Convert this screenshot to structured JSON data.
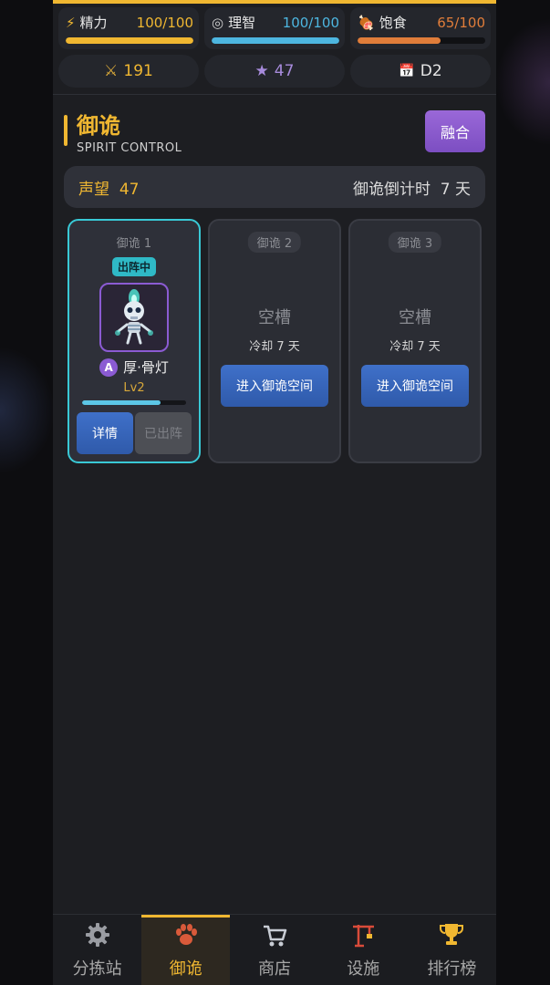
{
  "stats": [
    {
      "icon": "⚡",
      "icon_name": "lightning-icon",
      "name": "精力",
      "value": "100/100",
      "fill": 1.0,
      "color": "#f0b731"
    },
    {
      "icon": "◎",
      "icon_name": "target-icon",
      "name": "理智",
      "value": "100/100",
      "fill": 1.0,
      "color": "#4db6e0"
    },
    {
      "icon": "🍖",
      "icon_name": "meat-icon",
      "name": "饱食",
      "value": "65/100",
      "fill": 0.65,
      "color": "#e07d3a"
    }
  ],
  "chips": [
    {
      "icon": "⚔",
      "icon_name": "swords-icon",
      "value": "191",
      "color": "#f0b731"
    },
    {
      "icon": "★",
      "icon_name": "star-icon",
      "value": "47",
      "color": "#a78bdc"
    },
    {
      "icon": "📅",
      "icon_name": "calendar-icon",
      "value": "D2",
      "color": "#e6e6e6"
    }
  ],
  "header": {
    "title": "御诡",
    "subtitle": "SPIRIT CONTROL",
    "fuse_label": "融合"
  },
  "reputation": {
    "label": "声望",
    "value": "47",
    "countdown_label": "御诡倒计时",
    "countdown_value": "7 天"
  },
  "slots": {
    "s1": {
      "label": "御诡 1",
      "badge": "出阵中",
      "rank": "A",
      "name": "厚·骨灯",
      "level": "Lv2",
      "xp_fraction": 0.75,
      "detail_label": "详情",
      "deployed_label": "已出阵"
    },
    "s2": {
      "label": "御诡 2",
      "empty_text": "空槽",
      "cooldown": "冷却 7 天",
      "enter_label": "进入御诡空间"
    },
    "s3": {
      "label": "御诡 3",
      "empty_text": "空槽",
      "cooldown": "冷却 7 天",
      "enter_label": "进入御诡空间"
    }
  },
  "nav": [
    {
      "label": "分拣站",
      "icon_name": "gear-icon",
      "active": false
    },
    {
      "label": "御诡",
      "icon_name": "paw-icon",
      "active": true
    },
    {
      "label": "商店",
      "icon_name": "cart-icon",
      "active": false
    },
    {
      "label": "设施",
      "icon_name": "crane-icon",
      "active": false
    },
    {
      "label": "排行榜",
      "icon_name": "trophy-icon",
      "active": false
    }
  ]
}
